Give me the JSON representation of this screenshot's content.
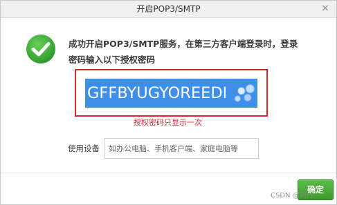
{
  "dialog": {
    "title": "开启POP3/SMTP",
    "close_glyph": "×",
    "message": "成功开启POP3/SMTP服务，在第三方客户端登录时，登录密码输入以下授权密码",
    "auth_code": "GFFBYUGYOREEDI",
    "auth_code_warning": "授权密码只显示一次",
    "device_label": "使用设备",
    "device_input": {
      "value": "",
      "placeholder": "如办公电脑、手机客户端、家庭电脑等"
    },
    "confirm_label": "确定"
  },
  "watermark": "CSDN @刘行",
  "icons": {
    "success": "checkmark-circle-icon",
    "close": "close-icon"
  },
  "colors": {
    "success_green": "#3aa13a",
    "code_highlight": "#3f8fe9",
    "warning_red": "#d9262f",
    "confirm_green": "#4aad3b"
  }
}
